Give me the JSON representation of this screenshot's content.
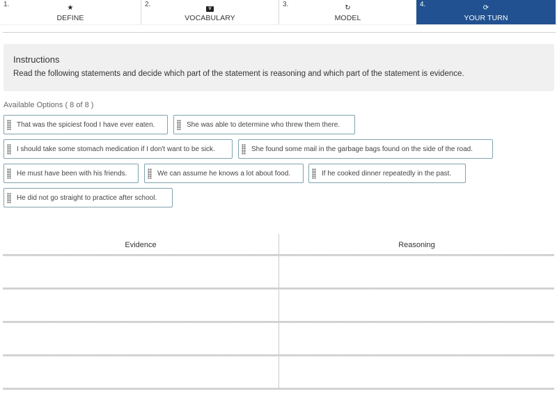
{
  "tabs": [
    {
      "number": "1.",
      "icon": "star-icon",
      "glyph": "★",
      "label": "DEFINE",
      "active": false
    },
    {
      "number": "2.",
      "icon": "vocabulary-icon",
      "glyph": "V",
      "label": "VOCABULARY",
      "active": false
    },
    {
      "number": "3.",
      "icon": "model-icon",
      "glyph": "↻",
      "label": "MODEL",
      "active": false
    },
    {
      "number": "4.",
      "icon": "your-turn-icon",
      "glyph": "⟳",
      "label": "YOUR TURN",
      "active": true
    }
  ],
  "instructions": {
    "title": "Instructions",
    "text": "Read the following statements and decide which part of the statement is reasoning and which part of the statement is evidence."
  },
  "available_options_label": "Available Options ( 8 of 8 )",
  "options": [
    "That was the spiciest food I have ever eaten.",
    "She was able to determine who threw them there.",
    "I should take some stomach medication if I don't want to be sick.",
    "She found some mail in the garbage bags found on the side of the road.",
    "He must have been with his friends.",
    "We can assume he knows a lot about food.",
    "If he cooked dinner repeatedly in the past.",
    "He did not go straight to practice after school."
  ],
  "table": {
    "headers": [
      "Evidence",
      "Reasoning"
    ],
    "rows": 4
  },
  "colors": {
    "active_tab": "#215190",
    "option_border": "#7fa3ad",
    "instructions_bg": "#f0f0f0"
  }
}
